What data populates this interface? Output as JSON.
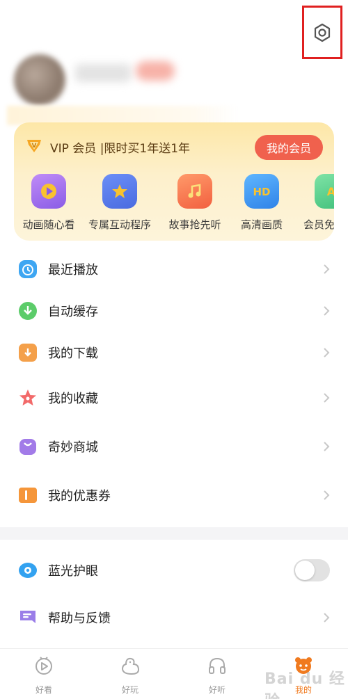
{
  "vip": {
    "title": "VIP 会员 |限时买1年送1年",
    "button": "我的会员",
    "perks": [
      {
        "label": "动画随心看",
        "icon": "play-icon"
      },
      {
        "label": "专属互动程序",
        "icon": "star-puzzle-icon"
      },
      {
        "label": "故事抢先听",
        "icon": "music-note-icon"
      },
      {
        "label": "高清画质",
        "icon": "hd-icon"
      },
      {
        "label": "会员免",
        "icon": "ad-free-icon"
      }
    ]
  },
  "menu": {
    "items": [
      {
        "label": "最近播放",
        "icon": "clock-icon",
        "color": "#3ea6f2"
      },
      {
        "label": "自动缓存",
        "icon": "auto-download-icon",
        "color": "#5ccc6a"
      },
      {
        "label": "我的下载",
        "icon": "download-icon",
        "color": "#f4a04a"
      },
      {
        "label": "我的收藏",
        "icon": "star-icon",
        "color": "#f26a6a"
      },
      {
        "label": "奇妙商城",
        "icon": "shopping-bag-icon",
        "color": "#a27be8"
      },
      {
        "label": "我的优惠券",
        "icon": "coupon-icon",
        "color": "#f5963a"
      }
    ]
  },
  "settings": {
    "items": [
      {
        "label": "蓝光护眼",
        "icon": "eye-icon",
        "color": "#33a2f0",
        "toggle": false
      },
      {
        "label": "帮助与反馈",
        "icon": "feedback-icon",
        "color": "#9a7de8"
      }
    ]
  },
  "tabs": [
    {
      "label": "好看",
      "icon": "tv-icon"
    },
    {
      "label": "好玩",
      "icon": "duck-icon"
    },
    {
      "label": "好听",
      "icon": "headphones-icon"
    },
    {
      "label": "我的",
      "icon": "profile-icon",
      "active": true
    }
  ],
  "watermark": "Bai du 经验"
}
